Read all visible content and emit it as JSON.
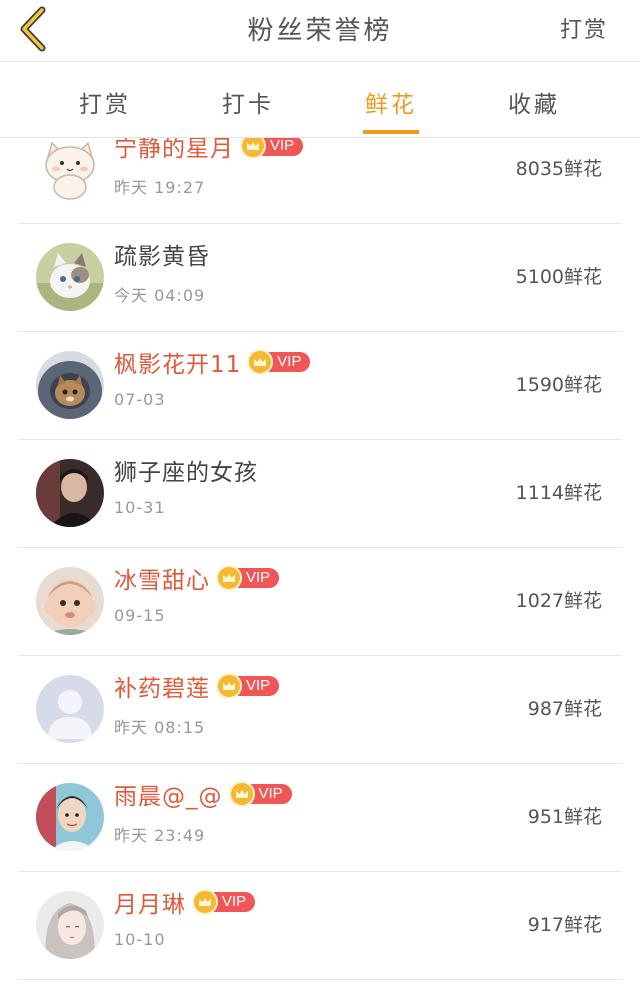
{
  "header": {
    "title": "粉丝荣誉榜",
    "action": "打赏",
    "back_icon": "chevron-left-icon",
    "accent": "#f29a1e"
  },
  "tabs": [
    {
      "label": "打赏",
      "active": false
    },
    {
      "label": "打卡",
      "active": false
    },
    {
      "label": "鲜花",
      "active": true
    },
    {
      "label": "收藏",
      "active": false
    }
  ],
  "vip_label": "VIP",
  "colors": {
    "vip_name": "#e05a3a",
    "vip_badge": "#f05656",
    "crown": "#f6b731"
  },
  "rows": [
    {
      "name": "宁静的星月",
      "vip": true,
      "time": "昨天 19:27",
      "flowers": "8035鲜花",
      "avatar": "white-cat-sticker-avatar"
    },
    {
      "name": "疏影黄昏",
      "vip": false,
      "time": "今天 04:09",
      "flowers": "5100鲜花",
      "avatar": "kitten-avatar"
    },
    {
      "name": "枫影花开11",
      "vip": true,
      "time": "07-03",
      "flowers": "1590鲜花",
      "avatar": "cat-in-hood-avatar"
    },
    {
      "name": "狮子座的女孩",
      "vip": false,
      "time": "10-31",
      "flowers": "1114鲜花",
      "avatar": "dark-portrait-avatar"
    },
    {
      "name": "冰雪甜心",
      "vip": true,
      "time": "09-15",
      "flowers": "1027鲜花",
      "avatar": "child-avatar"
    },
    {
      "name": "补药碧莲",
      "vip": true,
      "time": "昨天 08:15",
      "flowers": "987鲜花",
      "avatar": "default-user-avatar"
    },
    {
      "name": "雨晨@_@",
      "vip": true,
      "time": "昨天 23:49",
      "flowers": "951鲜花",
      "avatar": "boy-portrait-avatar"
    },
    {
      "name": "月月琳",
      "vip": true,
      "time": "10-10",
      "flowers": "917鲜花",
      "avatar": "illustrated-girl-avatar"
    }
  ]
}
